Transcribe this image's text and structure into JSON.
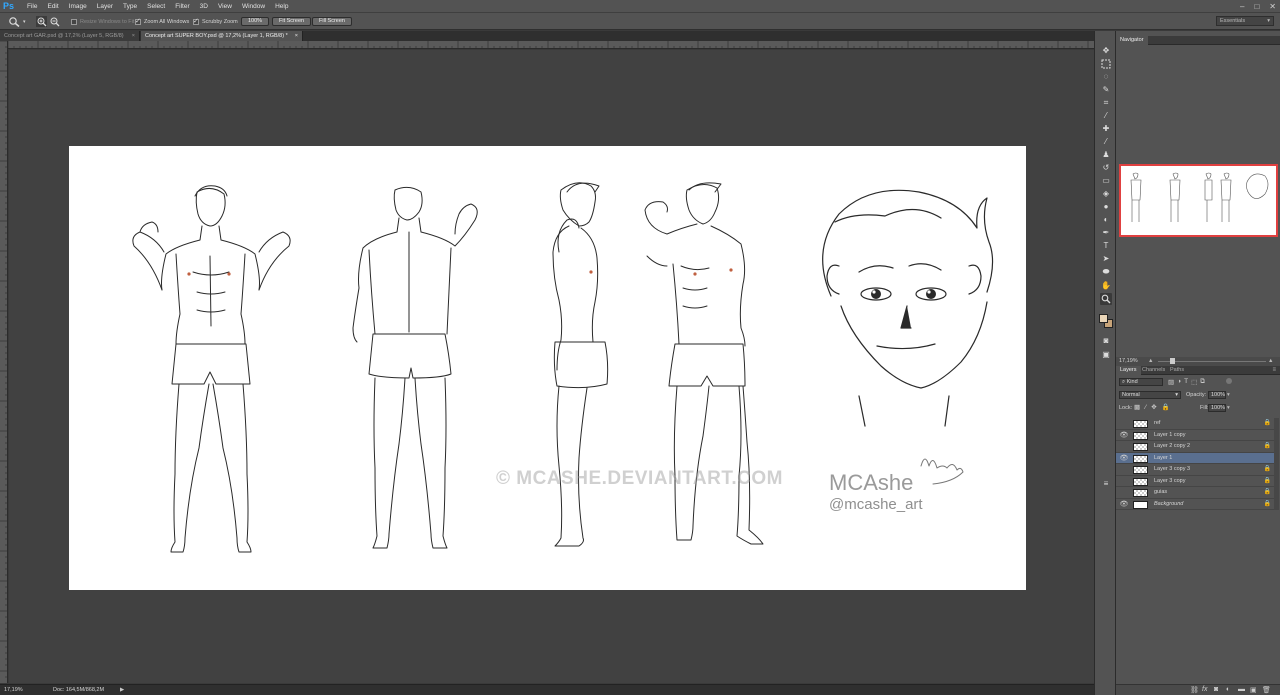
{
  "app": {
    "logo": "Ps"
  },
  "menu": [
    "File",
    "Edit",
    "Image",
    "Layer",
    "Type",
    "Select",
    "Filter",
    "3D",
    "View",
    "Window",
    "Help"
  ],
  "window_controls": {
    "minimize": "–",
    "maximize": "□",
    "close": "✕"
  },
  "options": {
    "resize_windows": "Resize Windows to Fit",
    "zoom_all": "Zoom All Windows",
    "scrubby": "Scrubby Zoom",
    "btn_100": "100%",
    "btn_fit": "Fit Screen",
    "btn_fill": "Fill Screen",
    "workspace": "Essentials"
  },
  "tabs": [
    {
      "label": "Concept art GAR.psd @ 17,2% (Layer 5, RGB/8)"
    },
    {
      "label": "Concept art SUPER BOY.psd @ 17,2% (Layer 1, RGB/8) *"
    }
  ],
  "status": {
    "zoom": "17,19%",
    "doc": "Doc: 164,5M/868,2M",
    "arrow": "▶"
  },
  "artwork": {
    "watermark": "© MCASHE.DEVIANTART.COM",
    "signature_name": "MCAshe",
    "signature_insta": "@mcashe_art"
  },
  "navigator": {
    "title": "Navigator",
    "zoom": "17,19%"
  },
  "layers_panel": {
    "tabs": [
      "Layers",
      "Channels",
      "Paths"
    ],
    "filter_kind": "Kind",
    "blend_mode": "Normal",
    "opacity_label": "Opacity:",
    "opacity_value": "100%",
    "lock_label": "Lock:",
    "fill_label": "Fill:",
    "fill_value": "100%",
    "layers": [
      {
        "name": "ref",
        "visible": false,
        "locked": true,
        "selected": false,
        "italic": false
      },
      {
        "name": "Layer 1 copy",
        "visible": true,
        "locked": false,
        "selected": false,
        "italic": false
      },
      {
        "name": "Layer 2 copy 2",
        "visible": false,
        "locked": true,
        "selected": false,
        "italic": false
      },
      {
        "name": "Layer 1",
        "visible": true,
        "locked": false,
        "selected": true,
        "italic": false
      },
      {
        "name": "Layer 3 copy 3",
        "visible": false,
        "locked": true,
        "selected": false,
        "italic": false
      },
      {
        "name": "Layer 3 copy",
        "visible": false,
        "locked": true,
        "selected": false,
        "italic": false
      },
      {
        "name": "guias",
        "visible": false,
        "locked": true,
        "selected": false,
        "italic": false
      },
      {
        "name": "Background",
        "visible": true,
        "locked": true,
        "selected": false,
        "italic": true
      }
    ]
  }
}
